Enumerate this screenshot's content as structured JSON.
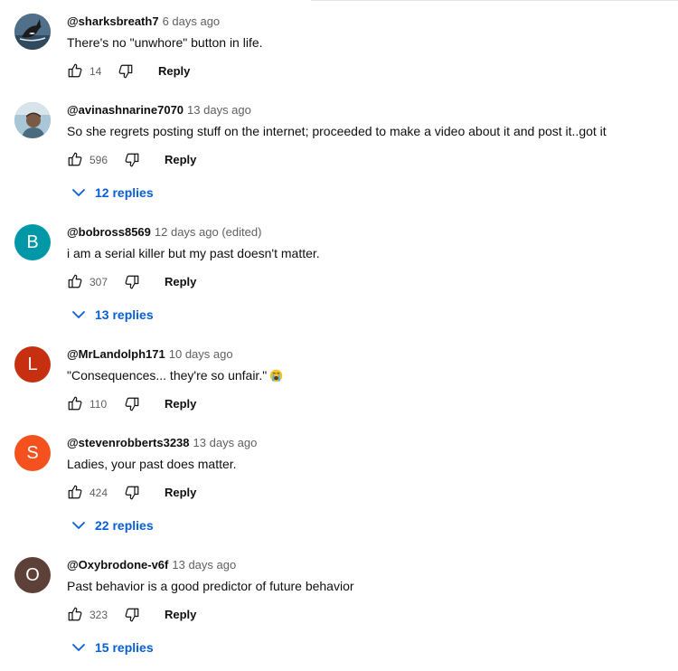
{
  "comments": [
    {
      "author": "@sharksbreath7",
      "time": "6 days ago",
      "text": "There's no \"unwhore\" button in life.",
      "likes": "14",
      "reply_label": "Reply",
      "avatar": {
        "type": "image",
        "icon": "orca-photo-avatar",
        "color": "#3d5a73"
      }
    },
    {
      "author": "@avinashnarine7070",
      "time": "13 days ago",
      "text": "So she regrets posting stuff on the internet; proceeded to make a video about it and post it..got it",
      "likes": "596",
      "reply_label": "Reply",
      "replies": "12 replies",
      "avatar": {
        "type": "image",
        "icon": "person-photo-avatar",
        "color": "#8fb3c9"
      }
    },
    {
      "author": "@bobross8569",
      "time": "12 days ago (edited)",
      "text": "i am a serial killer but my past doesn't matter.",
      "likes": "307",
      "reply_label": "Reply",
      "replies": "13 replies",
      "avatar": {
        "type": "letter",
        "letter": "B",
        "color": "#0097a7"
      }
    },
    {
      "author": "@MrLandolph171",
      "time": "10 days ago",
      "text": "\"Consequences... they're so unfair.\"",
      "emoji": "loudly-crying-face-emoji",
      "likes": "110",
      "reply_label": "Reply",
      "avatar": {
        "type": "letter",
        "letter": "L",
        "color": "#c62f0f"
      }
    },
    {
      "author": "@stevenrobberts3238",
      "time": "13 days ago",
      "text": "Ladies, your past does matter.",
      "likes": "424",
      "reply_label": "Reply",
      "replies": "22 replies",
      "avatar": {
        "type": "letter",
        "letter": "S",
        "color": "#f4511e"
      }
    },
    {
      "author": "@Oxybrodone-v6f",
      "time": "13 days ago",
      "text": "Past behavior is a good predictor of future behavior",
      "likes": "323",
      "reply_label": "Reply",
      "replies": "15 replies",
      "avatar": {
        "type": "letter",
        "letter": "O",
        "color": "#5d4037"
      }
    }
  ],
  "colors": {
    "link": "#065fd4",
    "secondary_text": "#606060",
    "primary_text": "#0f0f0f"
  }
}
